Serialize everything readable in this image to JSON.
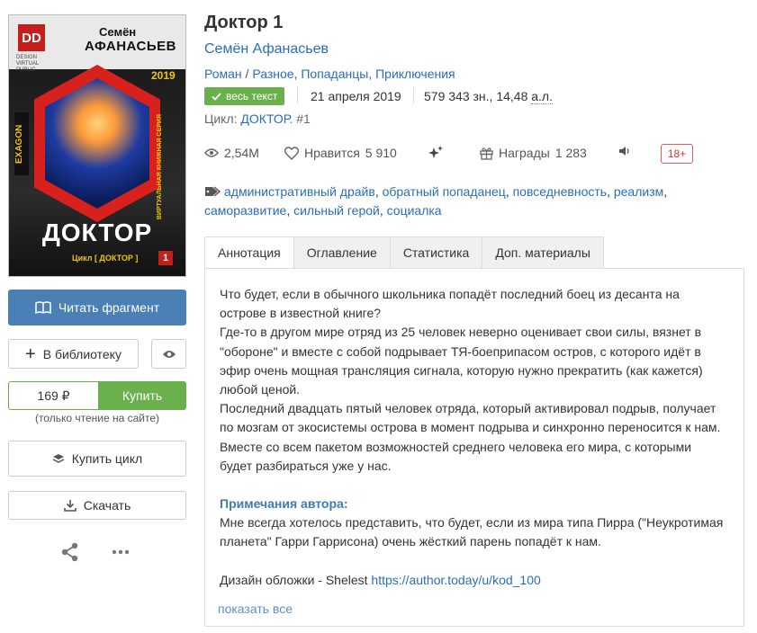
{
  "cover": {
    "logo": "DD",
    "logo_sub": [
      "DESIGN",
      "VIRTUAL",
      "PUBLIC"
    ],
    "author_first": "Семён",
    "author_last": "АФАНАСЬЕВ",
    "year": "2019",
    "exagon": "EXAGON",
    "series": "ВИРТУАЛЬНАЯ КНИЖНАЯ СЕРИЯ",
    "title": "ДОКТОР",
    "cycle": "Цикл [ ДОКТОР ]",
    "num": "1"
  },
  "sidebar": {
    "read_fragment": "Читать фрагмент",
    "to_library": "В библиотеку",
    "price": "169 ₽",
    "buy": "Купить",
    "only_read": "(только чтение на сайте)",
    "buy_cycle": "Купить цикл",
    "download": "Скачать"
  },
  "book": {
    "title": "Доктор 1",
    "author": "Семён Афанасьев",
    "genres": [
      "Роман",
      "Разное",
      "Попаданцы",
      "Приключения"
    ],
    "full_text_badge": "весь текст",
    "date": "21 апреля 2019",
    "size_chars": "579 343 зн., 14,48",
    "size_unit": "а.л.",
    "cycle_label": "Цикл:",
    "cycle_name": "ДОКТОР",
    "cycle_num": ". #1"
  },
  "stats": {
    "views": "2,54M",
    "likes_label": "Нравится",
    "likes": "5 910",
    "awards_label": "Награды",
    "awards": "1 283",
    "age": "18+"
  },
  "tags": [
    "административный драйв",
    "обратный попаданец",
    "повседневность",
    "реализм",
    "саморазвитие",
    "сильный герой",
    "социалка"
  ],
  "tabs": [
    "Аннотация",
    "Оглавление",
    "Статистика",
    "Доп. материалы"
  ],
  "annotation": {
    "p1": "Что будет, если в обычного школьника попадёт последний боец из десанта на острове в известной книге?",
    "p2": "Где-то в другом мире отряд из 25 человек неверно оценивает свои силы, вязнет в \"обороне\" и вместе с собой подрывает ТЯ-боеприпасом остров, с которого идёт в эфир очень мощная трансляция сигнала, которую нужно прекратить (как кажется) любой ценой.",
    "p3": "Последний двадцать пятый человек отряда, который активировал подрыв, получает по мозгам от экосистемы острова в момент подрыва и синхронно переносится к нам. Вместе со всем пакетом возможностей среднего человека его мира, с которыми будет разбираться уже у нас.",
    "notes_title": "Примечания автора:",
    "notes": "Мне всегда хотелось представить, что будет, если из мира типа Пирра (\"Неукротимая планета\" Гарри Гаррисона) очень жёсткий парень попадёт к нам.",
    "design_label": "Дизайн обложки - Shelest",
    "design_link": "https://author.today/u/kod_100",
    "show_all": "показать все"
  },
  "colors": {
    "accent_blue": "#4a80b5",
    "link": "#2a6ebb",
    "green": "#6ab04c",
    "age_red": "#e05c5c"
  }
}
